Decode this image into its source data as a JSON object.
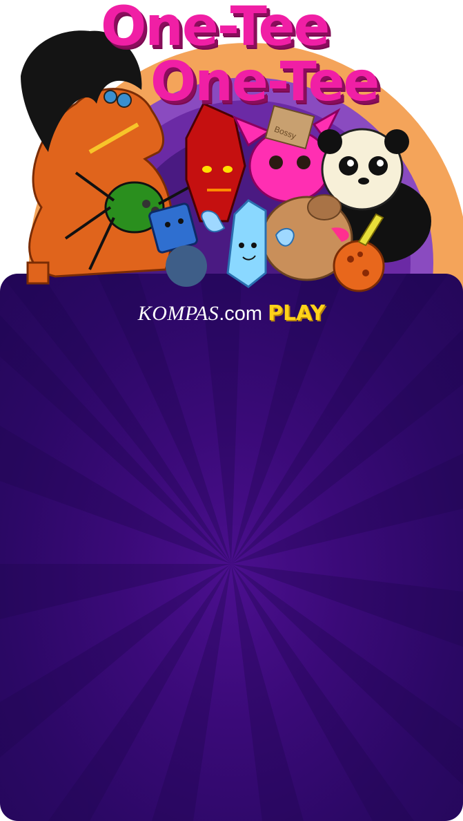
{
  "game": {
    "title_line1": "One-Tee",
    "title_line2": "One-Tee"
  },
  "brand": {
    "kompas": "KOMPAS",
    "com": ".com",
    "play": "PLAY"
  },
  "characters": {
    "box_label": "Bossy"
  },
  "colors": {
    "title_pink": "#f01fa5",
    "panel_purple": "#2b0865",
    "play_yellow": "#ffd21a",
    "sun_orange": "#f4a45a"
  }
}
